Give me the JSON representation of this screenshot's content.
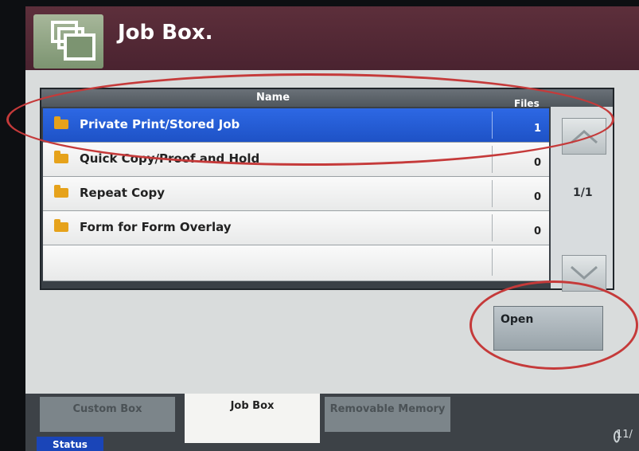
{
  "header": {
    "title": "Job Box."
  },
  "list": {
    "columns": {
      "name": "Name",
      "files": "Files"
    },
    "rows": [
      {
        "label": "Private Print/Stored Job",
        "count": "1",
        "selected": true
      },
      {
        "label": "Quick Copy/Proof and Hold",
        "count": "0",
        "selected": false
      },
      {
        "label": "Repeat Copy",
        "count": "0",
        "selected": false
      },
      {
        "label": "Form for Form Overlay",
        "count": "0",
        "selected": false
      }
    ]
  },
  "pagination": {
    "current": "1/1"
  },
  "actions": {
    "open": "Open"
  },
  "tabs": [
    {
      "label": "Custom Box",
      "active": false
    },
    {
      "label": "Job Box",
      "active": true
    },
    {
      "label": "Removable Memory",
      "active": false
    }
  ],
  "status": {
    "label": "Status"
  },
  "footer": {
    "text": "11/"
  },
  "colors": {
    "selection": "#1e52c6",
    "annotation": "#c53a3a",
    "header": "#4a2330"
  }
}
